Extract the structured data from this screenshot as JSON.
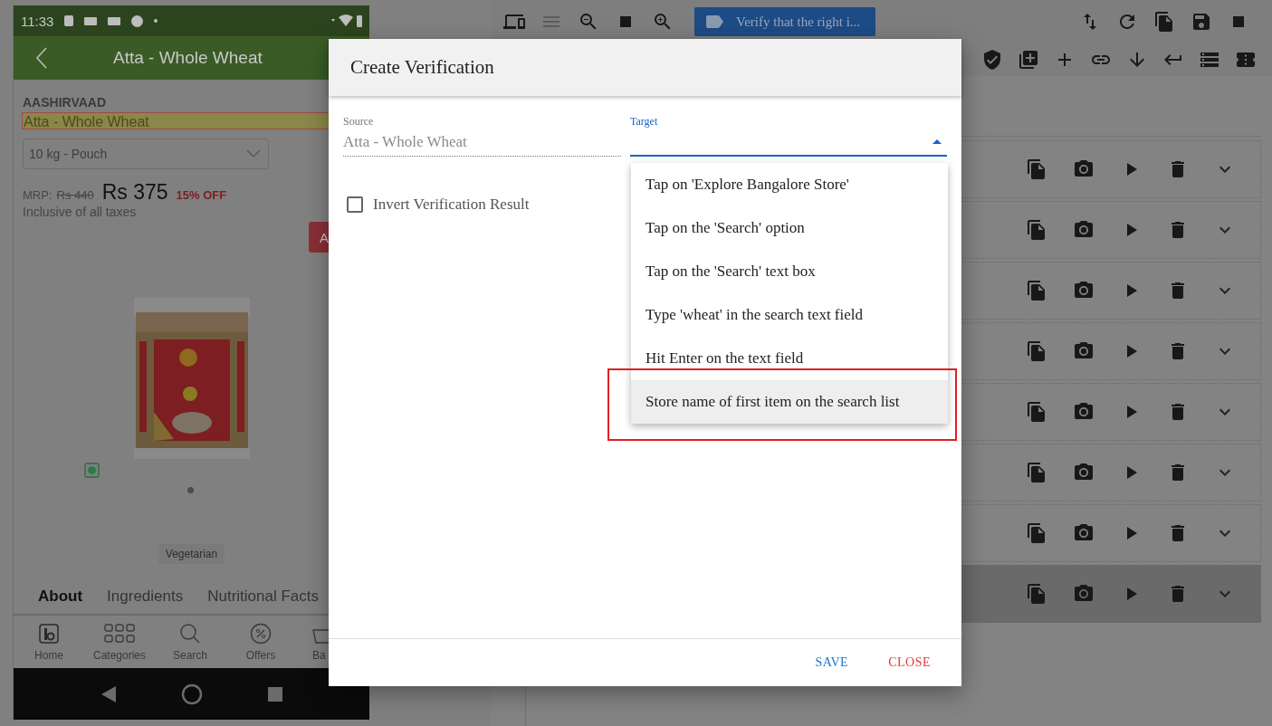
{
  "phone": {
    "status_bar": {
      "time": "11:33"
    },
    "header": {
      "title": "Atta - Whole Wheat"
    },
    "brand": "AASHIRVAAD",
    "product_name": "Atta - Whole Wheat",
    "variant": "10 kg - Pouch",
    "mrp_label": "MRP:",
    "mrp": "Rs 440",
    "price": "Rs 375",
    "discount": "15% OFF",
    "tax_note": "Inclusive of all taxes",
    "add_button": "A",
    "tag": "Vegetarian",
    "tabs": [
      {
        "label": "About",
        "selected": true
      },
      {
        "label": "Ingredients",
        "selected": false
      },
      {
        "label": "Nutritional Facts",
        "selected": false
      }
    ],
    "nav": [
      {
        "label": "Home",
        "kind": "home"
      },
      {
        "label": "Categories",
        "kind": "categories"
      },
      {
        "label": "Search",
        "kind": "search"
      },
      {
        "label": "Offers",
        "kind": "offers"
      },
      {
        "label": "Ba",
        "kind": "basket"
      }
    ]
  },
  "toolbar": {
    "step_chip": "Verify that the right i..."
  },
  "steps": [
    {
      "selected": false
    },
    {
      "selected": false
    },
    {
      "selected": false
    },
    {
      "selected": false
    },
    {
      "selected": false
    },
    {
      "selected": false
    },
    {
      "selected": false
    },
    {
      "selected": true
    }
  ],
  "dialog": {
    "title": "Create Verification",
    "source": {
      "label": "Source",
      "value": "Atta - Whole Wheat"
    },
    "target": {
      "label": "Target",
      "expanded": true
    },
    "invert": {
      "label": "Invert Verification Result",
      "checked": false
    },
    "options": [
      {
        "label": "Tap on 'Explore Bangalore Store'",
        "selected": false,
        "annotated": false
      },
      {
        "label": "Tap on the 'Search' option",
        "selected": false,
        "annotated": false
      },
      {
        "label": "Tap on the 'Search' text box",
        "selected": false,
        "annotated": false
      },
      {
        "label": "Type 'wheat' in the search text field",
        "selected": false,
        "annotated": false
      },
      {
        "label": "Hit Enter on the text field",
        "selected": false,
        "annotated": false
      },
      {
        "label": "Store name of first item on the search list",
        "selected": true,
        "annotated": true
      }
    ],
    "buttons": [
      {
        "label": "SAVE",
        "kind": "primary"
      },
      {
        "label": "CLOSE",
        "kind": "danger"
      }
    ]
  }
}
